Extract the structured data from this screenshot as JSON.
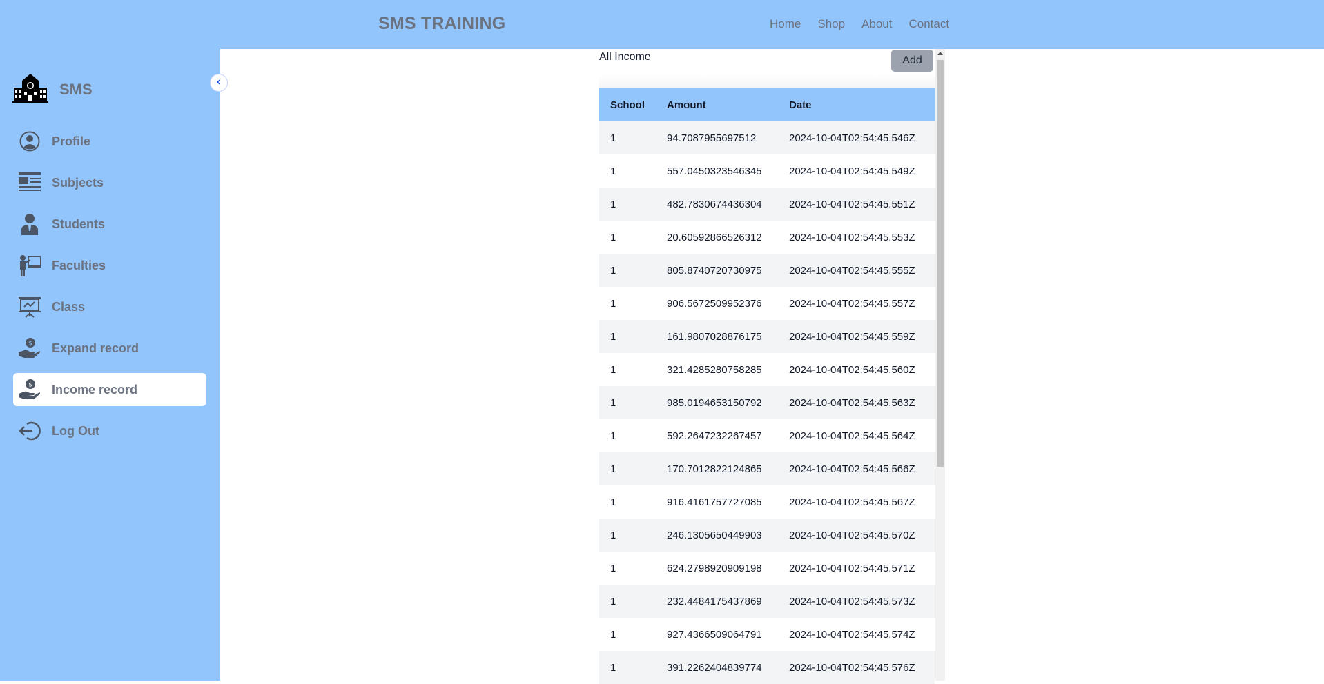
{
  "header": {
    "brand": "SMS TRAINING",
    "nav": [
      "Home",
      "Shop",
      "About",
      "Contact"
    ]
  },
  "sidebar": {
    "logo_title": "SMS",
    "items": [
      {
        "label": "Profile",
        "icon": "profile-icon"
      },
      {
        "label": "Subjects",
        "icon": "subjects-icon"
      },
      {
        "label": "Students",
        "icon": "students-icon"
      },
      {
        "label": "Faculties",
        "icon": "faculties-icon"
      },
      {
        "label": "Class",
        "icon": "class-icon"
      },
      {
        "label": "Expand record",
        "icon": "expand-record-icon"
      },
      {
        "label": "Income record",
        "icon": "income-record-icon",
        "active": true
      },
      {
        "label": "Log Out",
        "icon": "logout-icon"
      }
    ]
  },
  "main": {
    "title": "All Income",
    "add_label": "Add",
    "table": {
      "columns": [
        "School",
        "Amount",
        "Date"
      ],
      "rows": [
        [
          "1",
          "94.7087955697512",
          "2024-10-04T02:54:45.546Z"
        ],
        [
          "1",
          "557.0450323546345",
          "2024-10-04T02:54:45.549Z"
        ],
        [
          "1",
          "482.7830674436304",
          "2024-10-04T02:54:45.551Z"
        ],
        [
          "1",
          "20.60592866526312",
          "2024-10-04T02:54:45.553Z"
        ],
        [
          "1",
          "805.8740720730975",
          "2024-10-04T02:54:45.555Z"
        ],
        [
          "1",
          "906.5672509952376",
          "2024-10-04T02:54:45.557Z"
        ],
        [
          "1",
          "161.9807028876175",
          "2024-10-04T02:54:45.559Z"
        ],
        [
          "1",
          "321.4285280758285",
          "2024-10-04T02:54:45.560Z"
        ],
        [
          "1",
          "985.0194653150792",
          "2024-10-04T02:54:45.563Z"
        ],
        [
          "1",
          "592.2647232267457",
          "2024-10-04T02:54:45.564Z"
        ],
        [
          "1",
          "170.7012822124865",
          "2024-10-04T02:54:45.566Z"
        ],
        [
          "1",
          "916.4161757727085",
          "2024-10-04T02:54:45.567Z"
        ],
        [
          "1",
          "246.1305650449903",
          "2024-10-04T02:54:45.570Z"
        ],
        [
          "1",
          "624.2798920909198",
          "2024-10-04T02:54:45.571Z"
        ],
        [
          "1",
          "232.4484175437869",
          "2024-10-04T02:54:45.573Z"
        ],
        [
          "1",
          "927.4366509064791",
          "2024-10-04T02:54:45.574Z"
        ],
        [
          "1",
          "391.2262404839774",
          "2024-10-04T02:54:45.576Z"
        ]
      ]
    }
  },
  "colors": {
    "accent": "#93c5fd",
    "text_muted": "#6b7280",
    "row_alt": "#f3f4f6",
    "button": "#9ca3af"
  }
}
